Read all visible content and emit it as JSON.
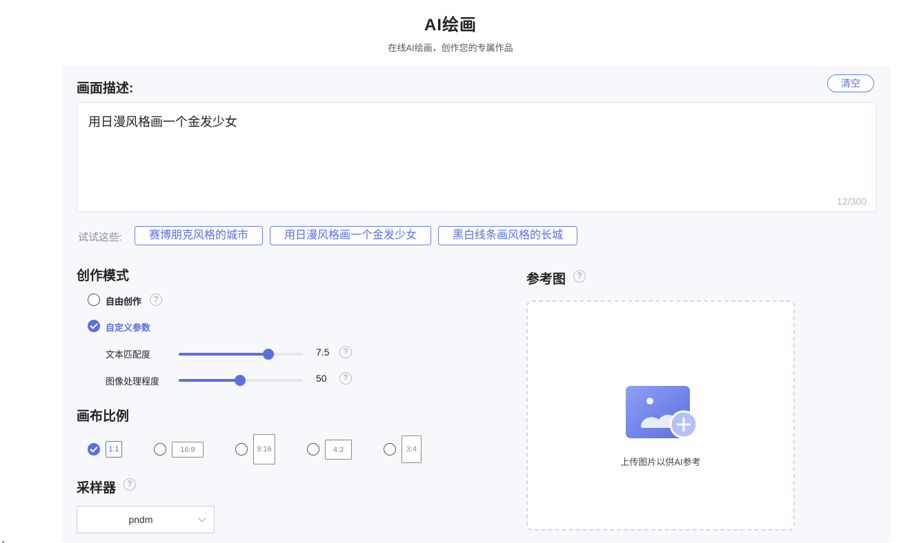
{
  "header": {
    "title": "AI绘画",
    "subtitle": "在线AI绘画，创作您的专属作品"
  },
  "description": {
    "label": "画面描述:",
    "clear_label": "清空",
    "text": "用日漫风格画一个金发少女",
    "count": "12/300"
  },
  "suggestions": {
    "label": "试试这些:",
    "items": [
      "赛博朋克风格的城市",
      "用日漫风格画一个金发少女",
      "黑白线条画风格的长城"
    ]
  },
  "mode": {
    "title": "创作模式",
    "options": [
      {
        "label": "自由创作",
        "checked": false
      },
      {
        "label": "自定义参数",
        "checked": true
      }
    ],
    "params": [
      {
        "label": "文本匹配度",
        "value": "7.5",
        "fraction": 0.72
      },
      {
        "label": "图像处理程度",
        "value": "50",
        "fraction": 0.495
      }
    ]
  },
  "ratio": {
    "title": "画布比例",
    "options": [
      {
        "label": "1:1",
        "checked": true
      },
      {
        "label": "16:9",
        "checked": false
      },
      {
        "label": "9:16",
        "checked": false
      },
      {
        "label": "4:3",
        "checked": false
      },
      {
        "label": "3:4",
        "checked": false
      }
    ]
  },
  "sampler": {
    "title": "采样器",
    "selected": "pndm"
  },
  "reference": {
    "title": "参考图",
    "upload_text": "上传图片以供AI参考"
  },
  "colors": {
    "accent": "#5b6ee0",
    "panel_bg": "#f7f8fc"
  },
  "icons": {
    "help": "question-circle-icon",
    "check": "check-circle-icon",
    "upload": "image-plus-icon",
    "dropdown": "chevron-down-icon"
  }
}
